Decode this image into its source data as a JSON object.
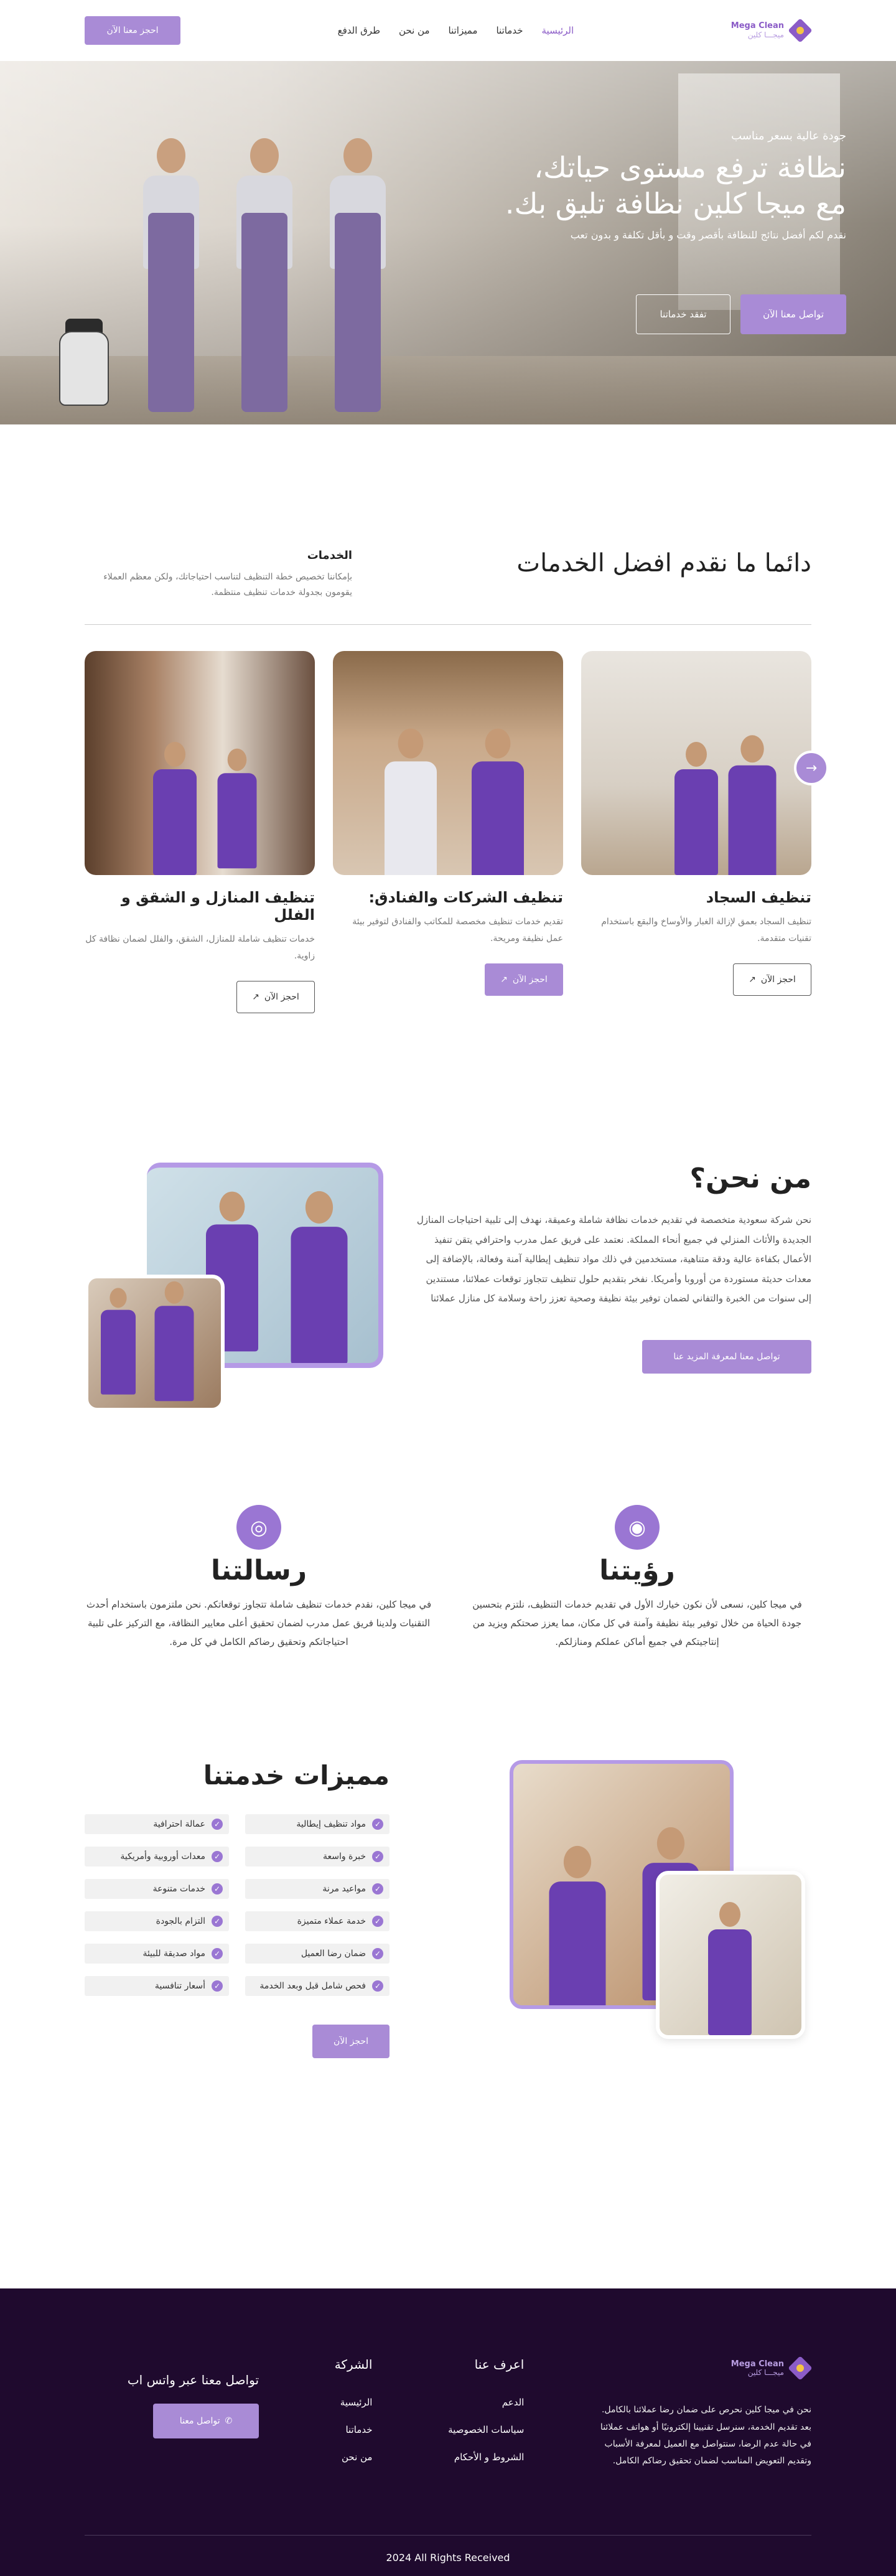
{
  "brand": {
    "name_en": "Mega Clean",
    "name_ar": "ميجـــا كلين"
  },
  "nav": {
    "items": [
      "الرئيسية",
      "خدماتنا",
      "مميزاتنا",
      "من نحن",
      "طرق الدفع"
    ],
    "book_label": "احجز معنا الآن"
  },
  "hero": {
    "tag": "جودة عالية بسعر مناسب",
    "title_line1": "نظافة ترفع مستوى حياتك،",
    "title_line2": "مع ميجا كلين نظافة تليق بك.",
    "subtitle": "نقدم لكم أفضل نتائج للنظافة بأقصر وقت و بأقل تكلفة و بدون تعب",
    "contact_label": "تواصل معنا الآن",
    "services_label": "تفقد خدماتنا"
  },
  "services": {
    "title": "دائما ما نقدم افضل الخدمات",
    "side_title": "الخدمات",
    "side_text": "بإمكاننا تخصيص خطة التنظيف لتناسب احتياجاتك، ولكن معظم العملاء يقومون بجدولة خدمات تنظيف منتظمة.",
    "cards": [
      {
        "title": "تنظيف السجاد",
        "text": "تنظيف السجاد بعمق لإزالة الغبار والأوساخ والبقع باستخدام تقنيات متقدمة.",
        "btn": "احجز الآن"
      },
      {
        "title": "تنظيف الشركات والفنادق:",
        "text": "تقديم خدمات تنظيف مخصصة للمكاتب والفنادق لتوفير بيئة عمل نظيفة ومريحة.",
        "btn": "احجز الآن"
      },
      {
        "title": "تنظيف المنازل و الشقق و الفلل",
        "text": "خدمات تنظيف شاملة للمنازل، الشقق، والفلل لضمان نظافة كل زاوية.",
        "btn": "احجز الآن"
      }
    ]
  },
  "about": {
    "title": "من نحن؟",
    "text": "نحن شركة سعودية متخصصة في تقديم خدمات نظافة شاملة وعميقة، نهدف إلى تلبية احتياجات المنازل الجديدة والأثاث المنزلي في جميع أنحاء المملكة. نعتمد على فريق عمل مدرب واحترافي يتقن تنفيذ الأعمال بكفاءة عالية ودقة متناهية، مستخدمين في ذلك مواد تنظيف إيطالية آمنة وفعالة، بالإضافة إلى معدات حديثة مستوردة من أوروبا وأمريكا. نفخر بتقديم حلول تنظيف تتجاوز توقعات عملائنا، مستندين إلى سنوات من الخبرة والتفاني لضمان توفير بيئة نظيفة وصحية تعزز راحة وسلامة كل منازل عملائنا",
    "btn": "تواصل معنا لمعرفة المزيد عنا"
  },
  "vision": {
    "title": "رؤيتنا",
    "text": "في ميجا كلين، نسعى لأن نكون خيارك الأول في تقديم خدمات التنظيف، نلتزم بتحسين جودة الحياة من خلال توفير بيئة نظيفة وآمنة في كل مكان، مما يعزز صحتكم ويزيد من إنتاجيتكم في جميع أماكن عملكم ومنازلكم."
  },
  "mission": {
    "title": "رسالتنا",
    "text": "في ميجا كلين، نقدم خدمات تنظيف شاملة تتجاوز توقعاتكم. نحن ملتزمون باستخدام أحدث التقنيات ولدينا فريق عمل مدرب لضمان تحقيق أعلى معايير النظافة، مع التركيز على تلبية احتياجاتكم وتحقيق رضاكم الكامل في كل مرة."
  },
  "features": {
    "title": "مميزات خدمتنا",
    "items": [
      "مواد تنظيف إيطالية",
      "عمالة احترافية",
      "خبرة واسعة",
      "معدات أوروبية وأمريكية",
      "مواعيد مرنة",
      "خدمات متنوعة",
      "خدمة عملاء متميزة",
      "التزام بالجودة",
      "ضمان رضا العميل",
      "مواد صديقة للبيئة",
      "فحص شامل قبل وبعد الخدمة",
      "أسعار تنافسية"
    ],
    "btn": "احجز الآن"
  },
  "footer": {
    "about_text": "نحن في ميجا كلين نحرص على ضمان رضا عملائنا بالكامل. بعد تقديم الخدمة، سنرسل تقنيينا إلكترونيًا أو هواتف عملائنا في حالة عدم الرضا، سنتواصل مع العميل لمعرفة الأسباب وتقديم التعويض المناسب لضمان تحقيق رضاكم الكامل.",
    "know_title": "اعرف عنا",
    "know_items": [
      "الدعم",
      "سياسات الخصوصية",
      "الشروط و الأحكام"
    ],
    "company_title": "الشركة",
    "company_items": [
      "الرئيسية",
      "خدماتنا",
      "من نحن"
    ],
    "contact_title": "تواصل معنا عبر واتس اب",
    "contact_btn": "تواصل معنا",
    "copyright": "2024 All Rights Received"
  },
  "colors": {
    "accent": "#a98bd6",
    "accent_dark": "#8b5cc7",
    "footer_bg": "#1f0a2e"
  },
  "icons": {
    "arrow": "arrow-up-right-icon",
    "check": "check-circle-icon",
    "whatsapp": "whatsapp-icon",
    "eye": "eye-icon",
    "target": "target-icon"
  }
}
